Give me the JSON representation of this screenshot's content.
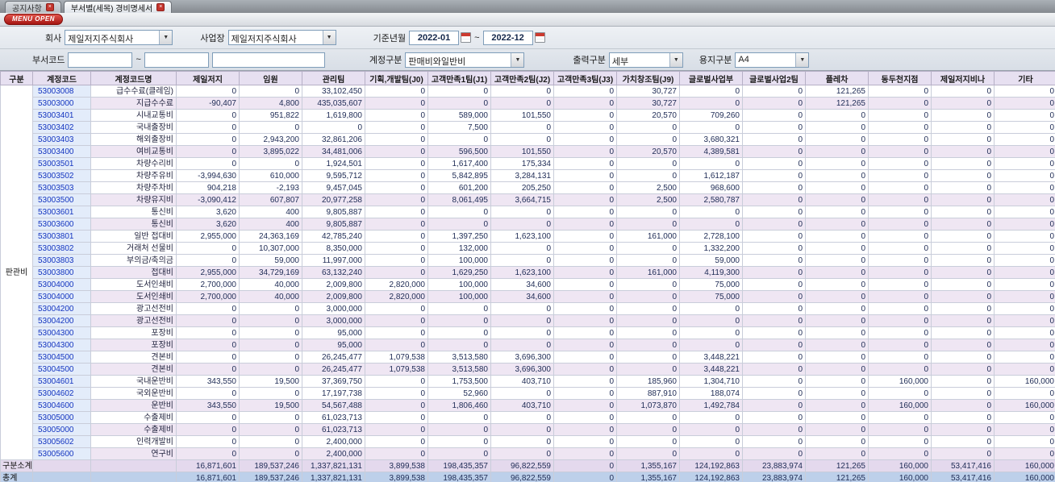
{
  "tabs": [
    {
      "label": "공지사항",
      "active": false
    },
    {
      "label": "부서별(세목) 경비명세서",
      "active": true
    }
  ],
  "menu_open_label": "MENU OPEN",
  "filters": {
    "company_label": "회사",
    "company_value": "제일저지주식회사",
    "workplace_label": "사업장",
    "workplace_value": "제일저지주식회사",
    "period_label": "기준년월",
    "period_from": "2022-01",
    "period_to": "2022-12",
    "period_separator": "~",
    "dept_code_label": "부서코드",
    "dept_code_separator": "~",
    "account_type_label": "계정구분",
    "account_type_value": "판매비와일반비",
    "output_type_label": "출력구분",
    "output_type_value": "세부",
    "paper_type_label": "용지구분",
    "paper_type_value": "A4"
  },
  "table": {
    "columns": [
      "구분",
      "계정코드",
      "계정코드명",
      "제일저지",
      "임원",
      "관리팀",
      "기획,개발팀(J0)",
      "고객만족1팀(J1)",
      "고객만족2팀(J2)",
      "고객만족3팀(J3)",
      "가치창조팀(J9)",
      "글로벌사업부",
      "글로벌사업2팀",
      "플레차",
      "동두천지점",
      "제일저지비나",
      "기타"
    ],
    "group_label": "판관비",
    "rows": [
      {
        "code": "53003008",
        "name": "급수수료(클레임)",
        "type": "detail",
        "values": [
          "0",
          "0",
          "33,102,450",
          "0",
          "0",
          "0",
          "0",
          "30,727",
          "0",
          "0",
          "121,265",
          "0",
          "0",
          "0"
        ]
      },
      {
        "code": "53003000",
        "name": "지급수수료",
        "type": "summary",
        "values": [
          "-90,407",
          "4,800",
          "435,035,607",
          "0",
          "0",
          "0",
          "0",
          "30,727",
          "0",
          "0",
          "121,265",
          "0",
          "0",
          "0"
        ]
      },
      {
        "code": "53003401",
        "name": "시내교통비",
        "type": "detail",
        "values": [
          "0",
          "951,822",
          "1,619,800",
          "0",
          "589,000",
          "101,550",
          "0",
          "20,570",
          "709,260",
          "0",
          "0",
          "0",
          "0",
          "0"
        ]
      },
      {
        "code": "53003402",
        "name": "국내출장비",
        "type": "detail",
        "values": [
          "0",
          "0",
          "0",
          "0",
          "7,500",
          "0",
          "0",
          "0",
          "0",
          "0",
          "0",
          "0",
          "0",
          "0"
        ]
      },
      {
        "code": "53003403",
        "name": "해외출장비",
        "type": "detail",
        "values": [
          "0",
          "2,943,200",
          "32,861,206",
          "0",
          "0",
          "0",
          "0",
          "0",
          "3,680,321",
          "0",
          "0",
          "0",
          "0",
          "0"
        ]
      },
      {
        "code": "53003400",
        "name": "여비교통비",
        "type": "summary",
        "values": [
          "0",
          "3,895,022",
          "34,481,006",
          "0",
          "596,500",
          "101,550",
          "0",
          "20,570",
          "4,389,581",
          "0",
          "0",
          "0",
          "0",
          "0"
        ]
      },
      {
        "code": "53003501",
        "name": "차량수리비",
        "type": "detail",
        "values": [
          "0",
          "0",
          "1,924,501",
          "0",
          "1,617,400",
          "175,334",
          "0",
          "0",
          "0",
          "0",
          "0",
          "0",
          "0",
          "0"
        ]
      },
      {
        "code": "53003502",
        "name": "차량주유비",
        "type": "detail",
        "values": [
          "-3,994,630",
          "610,000",
          "9,595,712",
          "0",
          "5,842,895",
          "3,284,131",
          "0",
          "0",
          "1,612,187",
          "0",
          "0",
          "0",
          "0",
          "0"
        ]
      },
      {
        "code": "53003503",
        "name": "차량주차비",
        "type": "detail",
        "values": [
          "904,218",
          "-2,193",
          "9,457,045",
          "0",
          "601,200",
          "205,250",
          "0",
          "2,500",
          "968,600",
          "0",
          "0",
          "0",
          "0",
          "0"
        ]
      },
      {
        "code": "53003500",
        "name": "차량유지비",
        "type": "summary",
        "values": [
          "-3,090,412",
          "607,807",
          "20,977,258",
          "0",
          "8,061,495",
          "3,664,715",
          "0",
          "2,500",
          "2,580,787",
          "0",
          "0",
          "0",
          "0",
          "0"
        ]
      },
      {
        "code": "53003601",
        "name": "통신비",
        "type": "detail",
        "values": [
          "3,620",
          "400",
          "9,805,887",
          "0",
          "0",
          "0",
          "0",
          "0",
          "0",
          "0",
          "0",
          "0",
          "0",
          "0"
        ]
      },
      {
        "code": "53003600",
        "name": "통신비",
        "type": "summary",
        "values": [
          "3,620",
          "400",
          "9,805,887",
          "0",
          "0",
          "0",
          "0",
          "0",
          "0",
          "0",
          "0",
          "0",
          "0",
          "0"
        ]
      },
      {
        "code": "53003801",
        "name": "일반 접대비",
        "type": "detail",
        "values": [
          "2,955,000",
          "24,363,169",
          "42,785,240",
          "0",
          "1,397,250",
          "1,623,100",
          "0",
          "161,000",
          "2,728,100",
          "0",
          "0",
          "0",
          "0",
          "0"
        ]
      },
      {
        "code": "53003802",
        "name": "거래처 선물비",
        "type": "detail",
        "values": [
          "0",
          "10,307,000",
          "8,350,000",
          "0",
          "132,000",
          "0",
          "0",
          "0",
          "1,332,200",
          "0",
          "0",
          "0",
          "0",
          "0"
        ]
      },
      {
        "code": "53003803",
        "name": "부의금/축의금",
        "type": "detail",
        "values": [
          "0",
          "59,000",
          "11,997,000",
          "0",
          "100,000",
          "0",
          "0",
          "0",
          "59,000",
          "0",
          "0",
          "0",
          "0",
          "0"
        ]
      },
      {
        "code": "53003800",
        "name": "접대비",
        "type": "summary",
        "values": [
          "2,955,000",
          "34,729,169",
          "63,132,240",
          "0",
          "1,629,250",
          "1,623,100",
          "0",
          "161,000",
          "4,119,300",
          "0",
          "0",
          "0",
          "0",
          "0"
        ]
      },
      {
        "code": "53004000",
        "name": "도서인쇄비",
        "type": "detail",
        "values": [
          "2,700,000",
          "40,000",
          "2,009,800",
          "2,820,000",
          "100,000",
          "34,600",
          "0",
          "0",
          "75,000",
          "0",
          "0",
          "0",
          "0",
          "0"
        ]
      },
      {
        "code": "53004000",
        "name": "도서인쇄비",
        "type": "summary",
        "values": [
          "2,700,000",
          "40,000",
          "2,009,800",
          "2,820,000",
          "100,000",
          "34,600",
          "0",
          "0",
          "75,000",
          "0",
          "0",
          "0",
          "0",
          "0"
        ]
      },
      {
        "code": "53004200",
        "name": "광고선전비",
        "type": "detail",
        "values": [
          "0",
          "0",
          "3,000,000",
          "0",
          "0",
          "0",
          "0",
          "0",
          "0",
          "0",
          "0",
          "0",
          "0",
          "0"
        ]
      },
      {
        "code": "53004200",
        "name": "광고선전비",
        "type": "summary",
        "values": [
          "0",
          "0",
          "3,000,000",
          "0",
          "0",
          "0",
          "0",
          "0",
          "0",
          "0",
          "0",
          "0",
          "0",
          "0"
        ]
      },
      {
        "code": "53004300",
        "name": "포장비",
        "type": "detail",
        "values": [
          "0",
          "0",
          "95,000",
          "0",
          "0",
          "0",
          "0",
          "0",
          "0",
          "0",
          "0",
          "0",
          "0",
          "0"
        ]
      },
      {
        "code": "53004300",
        "name": "포장비",
        "type": "summary",
        "values": [
          "0",
          "0",
          "95,000",
          "0",
          "0",
          "0",
          "0",
          "0",
          "0",
          "0",
          "0",
          "0",
          "0",
          "0"
        ]
      },
      {
        "code": "53004500",
        "name": "견본비",
        "type": "detail",
        "values": [
          "0",
          "0",
          "26,245,477",
          "1,079,538",
          "3,513,580",
          "3,696,300",
          "0",
          "0",
          "3,448,221",
          "0",
          "0",
          "0",
          "0",
          "0"
        ]
      },
      {
        "code": "53004500",
        "name": "견본비",
        "type": "summary",
        "values": [
          "0",
          "0",
          "26,245,477",
          "1,079,538",
          "3,513,580",
          "3,696,300",
          "0",
          "0",
          "3,448,221",
          "0",
          "0",
          "0",
          "0",
          "0"
        ]
      },
      {
        "code": "53004601",
        "name": "국내운반비",
        "type": "detail",
        "values": [
          "343,550",
          "19,500",
          "37,369,750",
          "0",
          "1,753,500",
          "403,710",
          "0",
          "185,960",
          "1,304,710",
          "0",
          "0",
          "160,000",
          "0",
          "160,000"
        ]
      },
      {
        "code": "53004602",
        "name": "국외운반비",
        "type": "detail",
        "values": [
          "0",
          "0",
          "17,197,738",
          "0",
          "52,960",
          "0",
          "0",
          "887,910",
          "188,074",
          "0",
          "0",
          "0",
          "0",
          "0"
        ]
      },
      {
        "code": "53004600",
        "name": "운반비",
        "type": "summary",
        "values": [
          "343,550",
          "19,500",
          "54,567,488",
          "0",
          "1,806,460",
          "403,710",
          "0",
          "1,073,870",
          "1,492,784",
          "0",
          "0",
          "160,000",
          "0",
          "160,000"
        ]
      },
      {
        "code": "53005000",
        "name": "수출제비",
        "type": "detail",
        "values": [
          "0",
          "0",
          "61,023,713",
          "0",
          "0",
          "0",
          "0",
          "0",
          "0",
          "0",
          "0",
          "0",
          "0",
          "0"
        ]
      },
      {
        "code": "53005000",
        "name": "수출제비",
        "type": "summary",
        "values": [
          "0",
          "0",
          "61,023,713",
          "0",
          "0",
          "0",
          "0",
          "0",
          "0",
          "0",
          "0",
          "0",
          "0",
          "0"
        ]
      },
      {
        "code": "53005602",
        "name": "인력개발비",
        "type": "detail",
        "values": [
          "0",
          "0",
          "2,400,000",
          "0",
          "0",
          "0",
          "0",
          "0",
          "0",
          "0",
          "0",
          "0",
          "0",
          "0"
        ]
      },
      {
        "code": "53005600",
        "name": "연구비",
        "type": "summary",
        "values": [
          "0",
          "0",
          "2,400,000",
          "0",
          "0",
          "0",
          "0",
          "0",
          "0",
          "0",
          "0",
          "0",
          "0",
          "0"
        ]
      }
    ],
    "footer_rows": [
      {
        "label": "구분소계",
        "type": "subtotal",
        "values": [
          "16,871,601",
          "189,537,246",
          "1,337,821,131",
          "3,899,538",
          "198,435,357",
          "96,822,559",
          "0",
          "1,355,167",
          "124,192,863",
          "23,883,974",
          "121,265",
          "160,000",
          "53,417,416",
          "160,000"
        ]
      },
      {
        "label": "총계",
        "type": "total",
        "values": [
          "16,871,601",
          "189,537,246",
          "1,337,821,131",
          "3,899,538",
          "198,435,357",
          "96,822,559",
          "0",
          "1,355,167",
          "124,192,863",
          "23,883,974",
          "121,265",
          "160,000",
          "53,417,416",
          "160,000"
        ]
      }
    ]
  }
}
